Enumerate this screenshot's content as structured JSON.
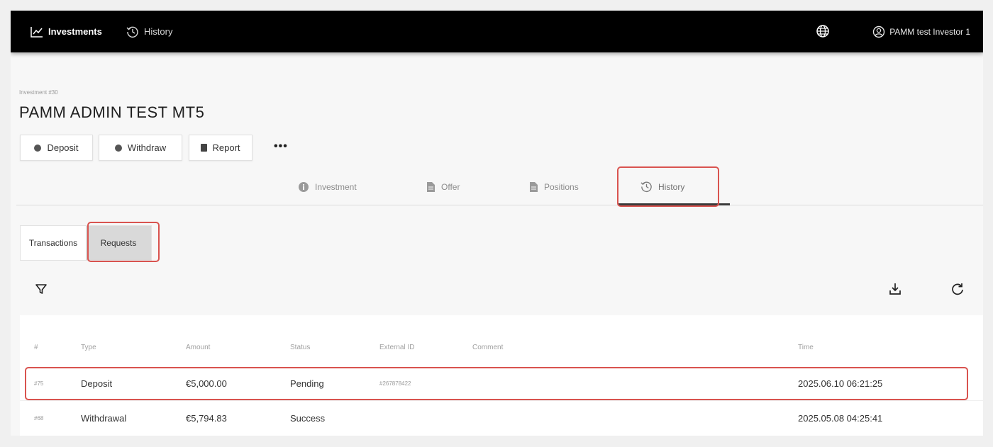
{
  "nav": {
    "investments_label": "Investments",
    "history_label": "History",
    "user_label": "PAMM test Investor 1"
  },
  "page": {
    "breadcrumb": "Investment #30",
    "title": "PAMM ADMIN TEST MT5"
  },
  "actions": {
    "deposit_label": "Deposit",
    "withdraw_label": "Withdraw",
    "report_label": "Report",
    "more_label": "•••"
  },
  "tabs": [
    {
      "label": "Investment"
    },
    {
      "label": "Offer"
    },
    {
      "label": "Positions"
    },
    {
      "label": "History"
    }
  ],
  "subtabs": [
    {
      "label": "Transactions"
    },
    {
      "label": "Requests"
    }
  ],
  "active_tab": "History",
  "active_subtab": "Requests",
  "table": {
    "headers": [
      "#",
      "Type",
      "Amount",
      "Status",
      "External ID",
      "Comment",
      "Time"
    ],
    "rows": [
      {
        "id": "#75",
        "type": "Deposit",
        "amount": "€5,000.00",
        "status": "Pending",
        "external_id": "#267878422",
        "comment": "",
        "time": "2025.06.10 06:21:25"
      },
      {
        "id": "#68",
        "type": "Withdrawal",
        "amount": "€5,794.83",
        "status": "Success",
        "external_id": "",
        "comment": "",
        "time": "2025.05.08 04:25:41"
      }
    ]
  },
  "colors": {
    "topbar": "#000000",
    "highlight": "#d9534f",
    "active_subtab": "#d9d9d9"
  }
}
